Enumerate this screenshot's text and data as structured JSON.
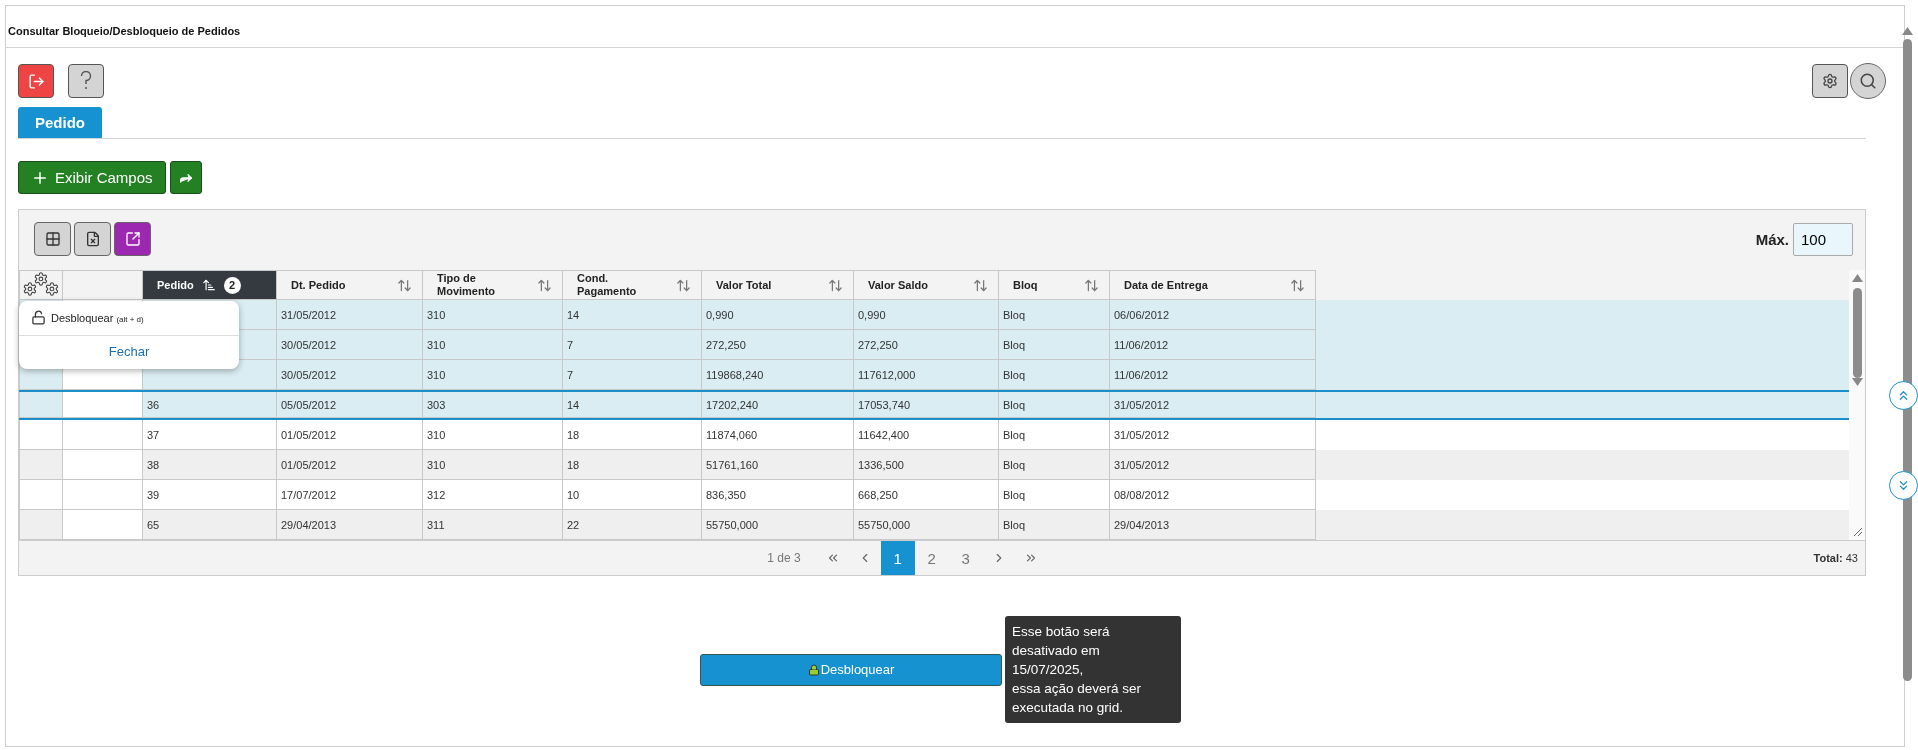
{
  "title": "Consultar Bloqueio/Desbloqueio de Pedidos",
  "tabs": [
    {
      "label": "Pedido",
      "selected": true
    }
  ],
  "add_button": "Exibir Campos",
  "grid": {
    "max_label": "Máx.",
    "max_value": "100",
    "columns": [
      {
        "label": "Pedido",
        "sorted": true,
        "badge": "2"
      },
      {
        "label": "Dt. Pedido",
        "sorted": false
      },
      {
        "label": "Tipo de Movimento",
        "sorted": false
      },
      {
        "label": "Cond. Pagamento",
        "sorted": false
      },
      {
        "label": "Valor Total",
        "sorted": false
      },
      {
        "label": "Valor Saldo",
        "sorted": false
      },
      {
        "label": "Bloq",
        "sorted": false
      },
      {
        "label": "Data de Entrega",
        "sorted": false
      }
    ],
    "rows": [
      {
        "selected": true,
        "focused": false,
        "cells": [
          null,
          "31/05/2012",
          "310",
          "14",
          "0,990",
          "0,990",
          "Bloq",
          "06/06/2012"
        ]
      },
      {
        "selected": true,
        "focused": false,
        "cells": [
          null,
          "30/05/2012",
          "310",
          "7",
          "272,250",
          "272,250",
          "Bloq",
          "11/06/2012"
        ]
      },
      {
        "selected": true,
        "focused": false,
        "cells": [
          null,
          "30/05/2012",
          "310",
          "7",
          "119868,240",
          "117612,000",
          "Bloq",
          "11/06/2012"
        ]
      },
      {
        "selected": true,
        "focused": true,
        "cells": [
          "36",
          "05/05/2012",
          "303",
          "14",
          "17202,240",
          "17053,740",
          "Bloq",
          "31/05/2012"
        ]
      },
      {
        "selected": false,
        "focused": false,
        "cells": [
          "37",
          "01/05/2012",
          "310",
          "18",
          "11874,060",
          "11642,400",
          "Bloq",
          "31/05/2012"
        ]
      },
      {
        "selected": false,
        "focused": false,
        "cells": [
          "38",
          "01/05/2012",
          "310",
          "18",
          "51761,160",
          "1336,500",
          "Bloq",
          "31/05/2012"
        ]
      },
      {
        "selected": false,
        "focused": false,
        "cells": [
          "39",
          "17/07/2012",
          "312",
          "10",
          "836,350",
          "668,250",
          "Bloq",
          "08/08/2012"
        ]
      },
      {
        "selected": false,
        "focused": false,
        "cells": [
          "65",
          "29/04/2013",
          "311",
          "22",
          "55750,000",
          "55750,000",
          "Bloq",
          "29/04/2013"
        ]
      }
    ],
    "context_menu": {
      "item": "Desbloquear",
      "shortcut": "(alt + d)",
      "close": "Fechar"
    },
    "pagination": {
      "summary": "1 de 3",
      "pages": [
        {
          "label": "1",
          "selected": true
        },
        {
          "label": "2",
          "selected": false
        },
        {
          "label": "3",
          "selected": false
        }
      ]
    },
    "total_label": "Total:",
    "total_value": "43"
  },
  "unlock_button": "Desbloquear",
  "tooltip": "Esse botão será desativado em\n15/07/2025,\nessa ação deverá ser executada no grid."
}
